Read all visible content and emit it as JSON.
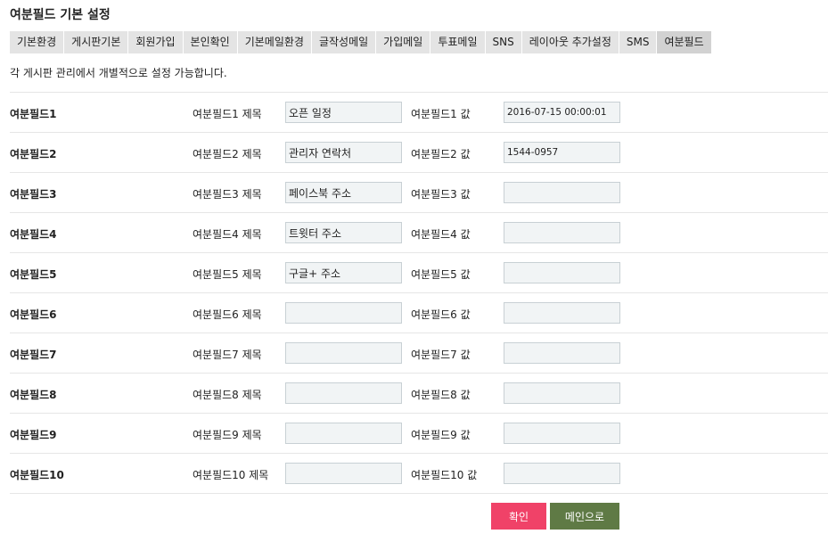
{
  "page": {
    "title": "여분필드 기본 설정",
    "description": "각 게시판 관리에서 개별적으로 설정 가능합니다."
  },
  "tabs": [
    {
      "label": "기본환경",
      "active": false
    },
    {
      "label": "게시판기본",
      "active": false
    },
    {
      "label": "회원가입",
      "active": false
    },
    {
      "label": "본인확인",
      "active": false
    },
    {
      "label": "기본메일환경",
      "active": false
    },
    {
      "label": "글작성메일",
      "active": false
    },
    {
      "label": "가입메일",
      "active": false
    },
    {
      "label": "투표메일",
      "active": false
    },
    {
      "label": "SNS",
      "active": false
    },
    {
      "label": "레이아웃 추가설정",
      "active": false
    },
    {
      "label": "SMS",
      "active": false
    },
    {
      "label": "여분필드",
      "active": true
    }
  ],
  "fields": [
    {
      "label": "여분필드1",
      "title_label": "여분필드1 제목",
      "title_value": "오픈 일정",
      "value_label": "여분필드1 값",
      "value": "2016-07-15 00:00:01"
    },
    {
      "label": "여분필드2",
      "title_label": "여분필드2 제목",
      "title_value": "관리자 연락처",
      "value_label": "여분필드2 값",
      "value": "1544-0957"
    },
    {
      "label": "여분필드3",
      "title_label": "여분필드3 제목",
      "title_value": "페이스북 주소",
      "value_label": "여분필드3 값",
      "value": ""
    },
    {
      "label": "여분필드4",
      "title_label": "여분필드4 제목",
      "title_value": "트윗터 주소",
      "value_label": "여분필드4 값",
      "value": ""
    },
    {
      "label": "여분필드5",
      "title_label": "여분필드5 제목",
      "title_value": "구글+ 주소",
      "value_label": "여분필드5 값",
      "value": ""
    },
    {
      "label": "여분필드6",
      "title_label": "여분필드6 제목",
      "title_value": "",
      "value_label": "여분필드6 값",
      "value": ""
    },
    {
      "label": "여분필드7",
      "title_label": "여분필드7 제목",
      "title_value": "",
      "value_label": "여분필드7 값",
      "value": ""
    },
    {
      "label": "여분필드8",
      "title_label": "여분필드8 제목",
      "title_value": "",
      "value_label": "여분필드8 값",
      "value": ""
    },
    {
      "label": "여분필드9",
      "title_label": "여분필드9 제목",
      "title_value": "",
      "value_label": "여분필드9 값",
      "value": ""
    },
    {
      "label": "여분필드10",
      "title_label": "여분필드10 제목",
      "title_value": "",
      "value_label": "여분필드10 값",
      "value": ""
    }
  ],
  "buttons": {
    "confirm_label": "확인",
    "main_label": "메인으로"
  },
  "colors": {
    "tab_bg": "#e4e4e4",
    "tab_active_bg": "#d2d2d2",
    "confirm": "#f04268",
    "main": "#5f7a45",
    "input_bg": "#f1f4f5",
    "input_border": "#c8d0d4"
  }
}
